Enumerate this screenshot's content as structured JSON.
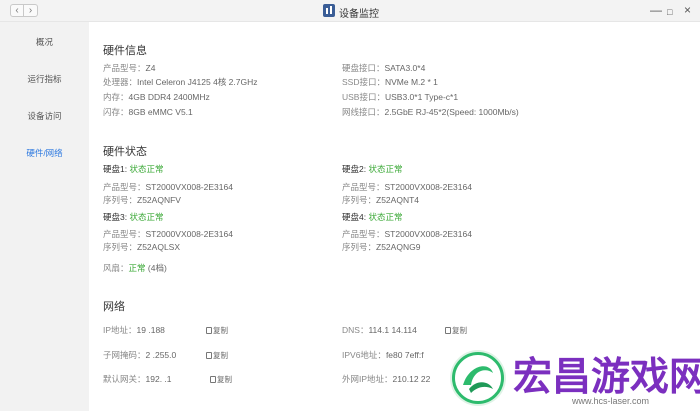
{
  "window": {
    "title": "设备监控",
    "back_label": "‹",
    "forward_label": "›",
    "minimize": "—",
    "maximize": "□",
    "close": "×"
  },
  "sidebar": {
    "items": [
      {
        "label": "概况",
        "active": false
      },
      {
        "label": "运行指标",
        "active": false
      },
      {
        "label": "设备访问",
        "active": false
      },
      {
        "label": "硬件/网络",
        "active": true
      }
    ]
  },
  "hardware_info": {
    "title": "硬件信息",
    "left": [
      {
        "k": "产品型号：",
        "v": "Z4"
      },
      {
        "k": "处理器：",
        "v": "Intel Celeron J4125 4核 2.7GHz"
      },
      {
        "k": "内存：",
        "v": "4GB DDR4 2400MHz"
      },
      {
        "k": "闪存：",
        "v": "8GB eMMC V5.1"
      }
    ],
    "right": [
      {
        "k": "硬盘接口：",
        "v": "SATA3.0*4"
      },
      {
        "k": "SSD接口：",
        "v": "NVMe M.2 * 1"
      },
      {
        "k": "USB接口：",
        "v": "USB3.0*1 Type-c*1"
      },
      {
        "k": "网线接口：",
        "v": "2.5GbE RJ-45*2(Speed: 1000Mb/s)"
      }
    ]
  },
  "hardware_status": {
    "title": "硬件状态",
    "disks": [
      {
        "name": "硬盘1:",
        "status": "状态正常",
        "model_k": "产品型号：",
        "model": "ST2000VX008-2E3164",
        "serial_k": "序列号：",
        "serial": "Z52AQNFV"
      },
      {
        "name": "硬盘2:",
        "status": "状态正常",
        "model_k": "产品型号：",
        "model": "ST2000VX008-2E3164",
        "serial_k": "序列号：",
        "serial": "Z52AQNT4"
      },
      {
        "name": "硬盘3:",
        "status": "状态正常",
        "model_k": "产品型号：",
        "model": "ST2000VX008-2E3164",
        "serial_k": "序列号：",
        "serial": "Z52AQLSX"
      },
      {
        "name": "硬盘4:",
        "status": "状态正常",
        "model_k": "产品型号：",
        "model": "ST2000VX008-2E3164",
        "serial_k": "序列号：",
        "serial": "Z52AQNG9"
      }
    ],
    "fan": {
      "k": "风扇：",
      "status": "正常",
      "level": "(4档)"
    }
  },
  "network": {
    "title": "网络",
    "copy_label": "复制",
    "left": [
      {
        "k": "IP地址：",
        "v": "19   .188"
      },
      {
        "k": "子网掩码：",
        "v": "2   .255.0"
      },
      {
        "k": "默认网关：",
        "v": "192.   .1"
      }
    ],
    "right": [
      {
        "k": "DNS：",
        "v": "114.1   14.114"
      },
      {
        "k": "IPV6地址：",
        "v": "fe80   7eff:f"
      },
      {
        "k": "外网IP地址：",
        "v": "210.12   22"
      }
    ]
  },
  "watermark": {
    "text": "宏昌游戏网",
    "url": "www.hcs-laser.com"
  }
}
